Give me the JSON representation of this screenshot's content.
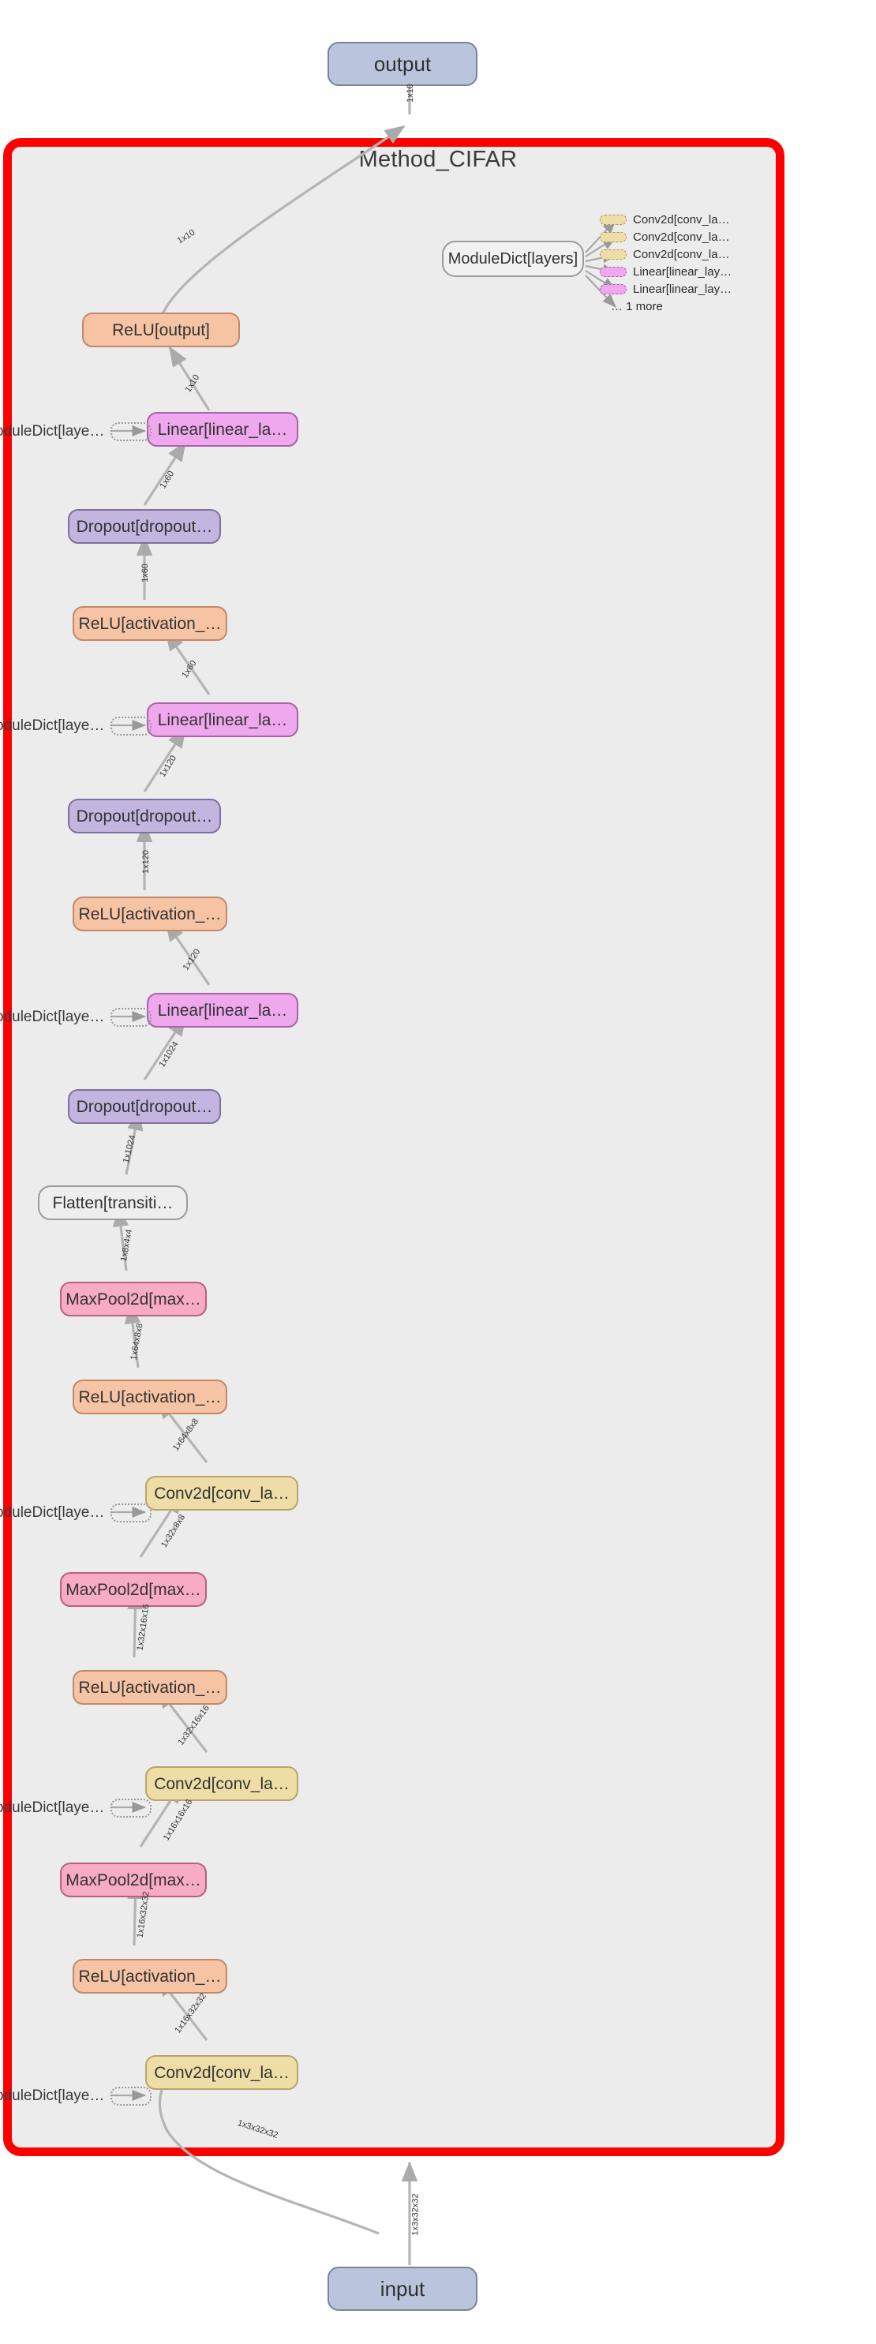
{
  "diagram": {
    "title": "Method_CIFAR",
    "cluster_border_color": "#ff0000",
    "cluster_bg_color": "#ececec",
    "io_nodes": {
      "output": "output",
      "input": "input"
    },
    "moduledict_node": "ModuleDict[layers]",
    "side_ref_label": "oduleDict[laye…",
    "legend": {
      "items": [
        {
          "label": "Conv2d[conv_la…",
          "type": "conv"
        },
        {
          "label": "Conv2d[conv_la…",
          "type": "conv"
        },
        {
          "label": "Conv2d[conv_la…",
          "type": "conv"
        },
        {
          "label": "Linear[linear_lay…",
          "type": "linear"
        },
        {
          "label": "Linear[linear_lay…",
          "type": "linear"
        }
      ],
      "more": "… 1 more"
    },
    "nodes": [
      {
        "id": "relu_output",
        "label": "ReLU[output]",
        "type": "relu"
      },
      {
        "id": "linear_3",
        "label": "Linear[linear_la…",
        "type": "linear"
      },
      {
        "id": "dropout_3",
        "label": "Dropout[dropout…",
        "type": "dropout"
      },
      {
        "id": "relu_3",
        "label": "ReLU[activation_…",
        "type": "relu"
      },
      {
        "id": "linear_2",
        "label": "Linear[linear_la…",
        "type": "linear"
      },
      {
        "id": "dropout_2",
        "label": "Dropout[dropout…",
        "type": "dropout"
      },
      {
        "id": "relu_2",
        "label": "ReLU[activation_…",
        "type": "relu"
      },
      {
        "id": "linear_1",
        "label": "Linear[linear_la…",
        "type": "linear"
      },
      {
        "id": "dropout_1",
        "label": "Dropout[dropout…",
        "type": "dropout"
      },
      {
        "id": "flatten",
        "label": "Flatten[transiti…",
        "type": "flatten"
      },
      {
        "id": "maxpool_3",
        "label": "MaxPool2d[max…",
        "type": "maxpool"
      },
      {
        "id": "relu_c3",
        "label": "ReLU[activation_…",
        "type": "relu"
      },
      {
        "id": "conv_3",
        "label": "Conv2d[conv_la…",
        "type": "conv"
      },
      {
        "id": "maxpool_2",
        "label": "MaxPool2d[max…",
        "type": "maxpool"
      },
      {
        "id": "relu_c2",
        "label": "ReLU[activation_…",
        "type": "relu"
      },
      {
        "id": "conv_2",
        "label": "Conv2d[conv_la…",
        "type": "conv"
      },
      {
        "id": "maxpool_1",
        "label": "MaxPool2d[max…",
        "type": "maxpool"
      },
      {
        "id": "relu_c1",
        "label": "ReLU[activation_…",
        "type": "relu"
      },
      {
        "id": "conv_1",
        "label": "Conv2d[conv_la…",
        "type": "conv"
      }
    ],
    "edge_labels": [
      {
        "id": "e_out",
        "text": "1x10"
      },
      {
        "id": "e_relu_out",
        "text": "1x10"
      },
      {
        "id": "e_lin3",
        "text": "1x10"
      },
      {
        "id": "e_drop3",
        "text": "1x60"
      },
      {
        "id": "e_relu3",
        "text": "1x60"
      },
      {
        "id": "e_lin2",
        "text": "1x60"
      },
      {
        "id": "e_drop2",
        "text": "1x120"
      },
      {
        "id": "e_relu2",
        "text": "1x120"
      },
      {
        "id": "e_lin1",
        "text": "1x120"
      },
      {
        "id": "e_drop1",
        "text": "1x1024"
      },
      {
        "id": "e_flat",
        "text": "1x1024"
      },
      {
        "id": "e_mp3",
        "text": "1x8x4x4"
      },
      {
        "id": "e_relu_c3",
        "text": "1x64x8x8"
      },
      {
        "id": "e_conv3",
        "text": "1x64x8x8"
      },
      {
        "id": "e_mp2",
        "text": "1x32x8x8"
      },
      {
        "id": "e_relu_c2",
        "text": "1x32x16x16"
      },
      {
        "id": "e_conv2",
        "text": "1x32x16x16"
      },
      {
        "id": "e_mp1",
        "text": "1x16x16x16"
      },
      {
        "id": "e_relu_c1",
        "text": "1x16x32x32"
      },
      {
        "id": "e_conv1",
        "text": "1x16x32x32"
      },
      {
        "id": "e_in_inner",
        "text": "1x3x32x32"
      },
      {
        "id": "e_in_outer",
        "text": "1x3x32x32"
      }
    ]
  }
}
